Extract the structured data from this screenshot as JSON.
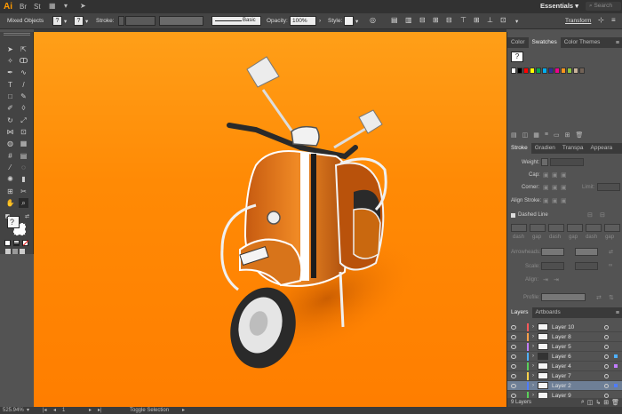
{
  "menubar": {
    "logo": "Ai",
    "workspace": "Essentials",
    "search_placeholder": "Search"
  },
  "controlbar": {
    "selection": "Mixed Objects",
    "stroke_label": "Stroke:",
    "stroke_style": "Basic",
    "opacity_label": "Opacity:",
    "opacity_value": "100%",
    "style_label": "Style:",
    "transform_label": "Transform",
    "help_glyph": "?"
  },
  "panels": {
    "swatch_tabs": [
      "Color",
      "Swatches",
      "Color Themes"
    ],
    "swatch_colors": [
      "#ffffff",
      "#000000",
      "#ff0000",
      "#ffff00",
      "#00a651",
      "#00aeef",
      "#2e3192",
      "#ec008c",
      "#f7941d",
      "#8dc63f",
      "#c7b299",
      "#736357"
    ],
    "stroke_tabs": [
      "Stroke",
      "Gradien",
      "Transpa",
      "Appeara"
    ],
    "stroke": {
      "weight_label": "Weight:",
      "cap_label": "Cap:",
      "corner_label": "Corner:",
      "limit_label": "Limit:",
      "align_label": "Align Stroke:",
      "dashed_label": "Dashed Line",
      "dash_cols": [
        "dash",
        "gap",
        "dash",
        "gap",
        "dash",
        "gap"
      ],
      "arrowheads_label": "Arrowheads:",
      "scale_label": "Scale:",
      "align2_label": "Align:",
      "profile_label": "Profile:"
    },
    "layer_tabs": [
      "Layers",
      "Artboards"
    ],
    "layers": [
      {
        "name": "Layer 10",
        "color": "#ff5a5a",
        "selected": false
      },
      {
        "name": "Layer 8",
        "color": "#ffa04a",
        "selected": false
      },
      {
        "name": "Layer 5",
        "color": "#c27dff",
        "selected": false
      },
      {
        "name": "Layer 6",
        "color": "#4fb0ff",
        "selected": false
      },
      {
        "name": "Layer 4",
        "color": "#5ad05a",
        "selected": false
      },
      {
        "name": "Layer 7",
        "color": "#ffd24a",
        "selected": false
      },
      {
        "name": "Layer 2",
        "color": "#4f7cff",
        "selected": true
      },
      {
        "name": "Layer 9",
        "color": "#5ad05a",
        "selected": false
      }
    ],
    "layers_count": "9 Layers"
  },
  "statusbar": {
    "zoom": "525.94%",
    "artboard": "1",
    "mode": "Toggle Selection"
  }
}
